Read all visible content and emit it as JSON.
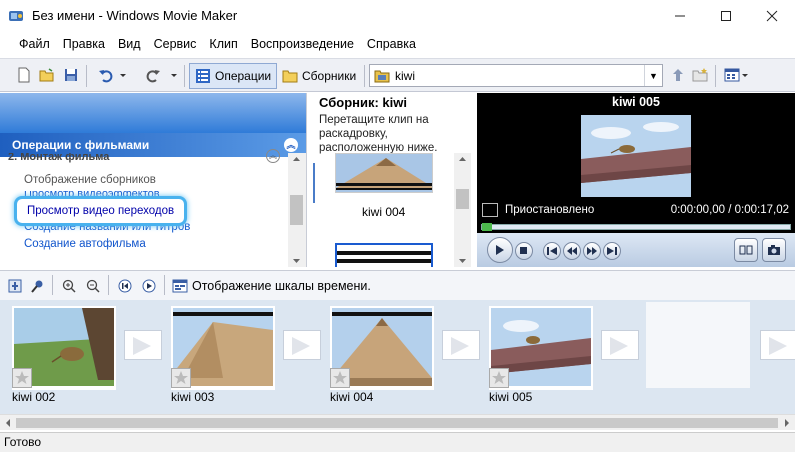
{
  "window": {
    "title": "Без имени - Windows Movie Maker",
    "minimize_icon": "minimize-icon",
    "maximize_icon": "maximize-icon",
    "close_icon": "close-icon"
  },
  "menu": {
    "items": [
      "Файл",
      "Правка",
      "Вид",
      "Сервис",
      "Клип",
      "Воспроизведение",
      "Справка"
    ]
  },
  "toolbar": {
    "tasks_label": "Операции",
    "collections_label": "Сборники",
    "collection_combo_value": "kiwi"
  },
  "tasks": {
    "header": "Операции с фильмами",
    "section": "2. Монтаж фильма",
    "links": [
      "Отображение сборников",
      "Просмотр видеоэффектов",
      "Просмотр видео переходов",
      "Создание названий или титров",
      "Создание автофильма"
    ]
  },
  "collection": {
    "title": "Сборник: kiwi",
    "description": "Перетащите клип на раскадровку, расположенную ниже.",
    "clip_label": "kiwi 004"
  },
  "monitor": {
    "title": "kiwi 005",
    "state": "Приостановлено",
    "time": "0:00:00,00 / 0:00:17,02",
    "progress": 0
  },
  "storyboard_toolbar": {
    "timeline_label": "Отображение шкалы времени."
  },
  "storyboard": {
    "clips": [
      {
        "label": "kiwi 002"
      },
      {
        "label": "kiwi 003"
      },
      {
        "label": "kiwi 004"
      },
      {
        "label": "kiwi 005"
      }
    ]
  },
  "status": {
    "text": "Готово"
  }
}
